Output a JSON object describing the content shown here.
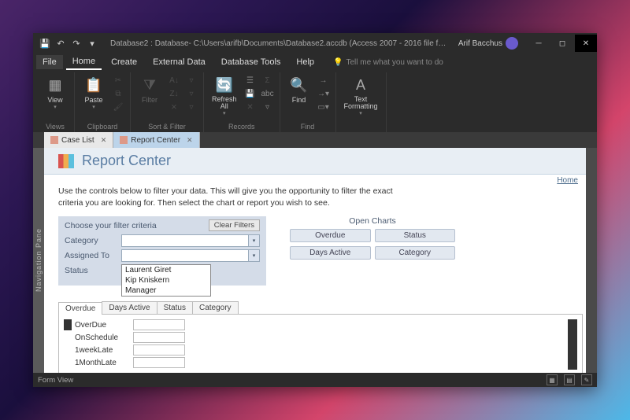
{
  "titlebar": {
    "title": "Database2 : Database- C:\\Users\\arifb\\Documents\\Database2.accdb (Access 2007 - 2016 file f…",
    "user": "Arif Bacchus"
  },
  "menubar": {
    "items": [
      "File",
      "Home",
      "Create",
      "External Data",
      "Database Tools",
      "Help"
    ],
    "tellme": "Tell me what you want to do"
  },
  "ribbon": {
    "groups": {
      "views": {
        "label": "Views",
        "view": "View"
      },
      "clipboard": {
        "label": "Clipboard",
        "paste": "Paste"
      },
      "sortfilter": {
        "label": "Sort & Filter",
        "filter": "Filter"
      },
      "records": {
        "label": "Records",
        "refresh": "Refresh\nAll"
      },
      "find": {
        "label": "Find",
        "find": "Find"
      },
      "textfmt": {
        "label": "",
        "text": "Text\nFormatting"
      }
    }
  },
  "doc_tabs": [
    {
      "label": "Case List"
    },
    {
      "label": "Report Center"
    }
  ],
  "navpane": "Navigation Pane",
  "form": {
    "title": "Report Center",
    "home_link": "Home",
    "instructions": "Use the controls below to filter your data. This will give you the opportunity to filter the exact criteria you are looking for. Then select the chart or report you wish to see.",
    "filter": {
      "heading": "Choose your filter criteria",
      "clear": "Clear Filters",
      "fields": {
        "category": "Category",
        "assigned": "Assigned To",
        "status": "Status"
      },
      "dropdown_options": [
        "Laurent Giret",
        "Kip Kniskern",
        "Manager"
      ]
    },
    "charts": {
      "heading": "Open Charts",
      "buttons": [
        "Overdue",
        "Status",
        "Days Active",
        "Category"
      ]
    },
    "subtabs": [
      "Overdue",
      "Days Active",
      "Status",
      "Category"
    ],
    "overdue_rows": [
      "OverDue",
      "OnSchedule",
      "1weekLate",
      "1MonthLate"
    ]
  },
  "statusbar": {
    "left": "Form View"
  }
}
